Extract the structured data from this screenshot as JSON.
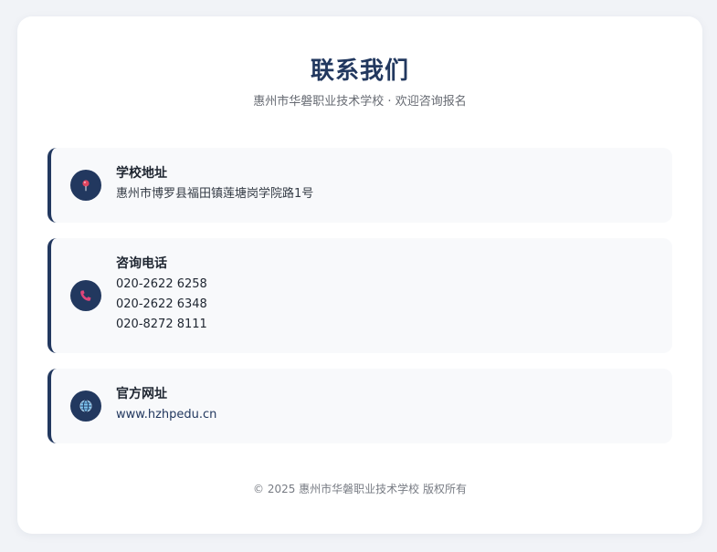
{
  "header": {
    "title": "联系我们",
    "subtitle": "惠州市华磐职业技术学校 · 欢迎咨询报名"
  },
  "contacts": {
    "address": {
      "icon": "location-pin-icon",
      "label": "学校地址",
      "value": "惠州市博罗县福田镇莲塘岗学院路1号"
    },
    "phone": {
      "icon": "phone-icon",
      "label": "咨询电话",
      "numbers": [
        "020-2622 6258",
        "020-2622 6348",
        "020-8272 8111"
      ]
    },
    "website": {
      "icon": "globe-icon",
      "label": "官方网址",
      "value": "www.hzhpedu.cn"
    }
  },
  "footer": {
    "text": "© 2025 惠州市华磐职业技术学校 版权所有"
  },
  "colors": {
    "accent": "#22385f",
    "background": "#f1f3f7",
    "card": "#ffffff",
    "item_background": "#f8f9fb",
    "pin": "#e0455f",
    "phone_icon": "#e0457a",
    "globe": "#7cc4f0"
  }
}
